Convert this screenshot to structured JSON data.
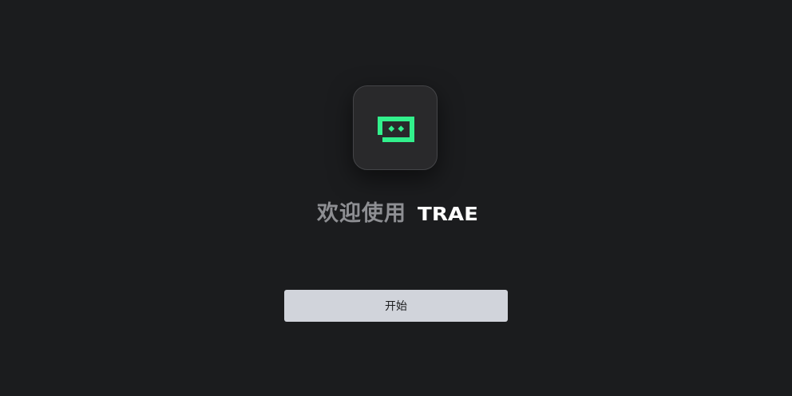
{
  "welcome": {
    "greeting": "欢迎使用",
    "brand_name": "TRAE"
  },
  "start_button": {
    "label": "开始"
  },
  "colors": {
    "background": "#1b1c1e",
    "icon_tile": "#29292b",
    "brand_green": "#32f08c",
    "greeting_text": "#8e8f93",
    "wordmark": "#ffffff",
    "button_bg": "#d1d4db"
  },
  "icons": {
    "app_logo": "trae-logo-icon"
  }
}
